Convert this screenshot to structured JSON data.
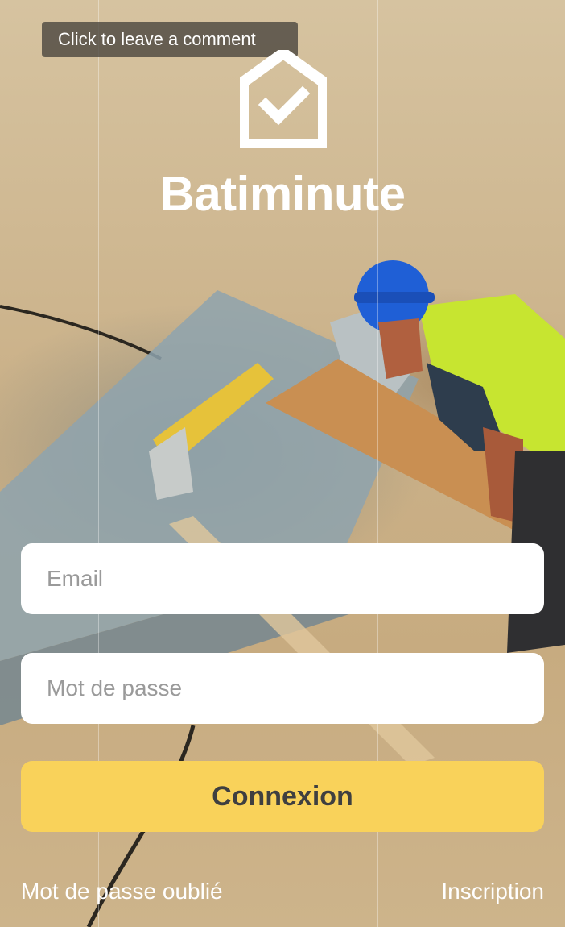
{
  "tooltip": {
    "text": "Click to leave a comment"
  },
  "brand": {
    "name": "Batiminute",
    "logo_icon": "house-check-icon"
  },
  "form": {
    "email_placeholder": "Email",
    "password_placeholder": "Mot de passe",
    "submit_label": "Connexion"
  },
  "links": {
    "forgot_password": "Mot de passe oublié",
    "signup": "Inscription"
  },
  "colors": {
    "accent": "#f9d25a",
    "button_text": "#3f3f40",
    "field_bg": "#ffffff",
    "placeholder": "#9a9a9a"
  }
}
